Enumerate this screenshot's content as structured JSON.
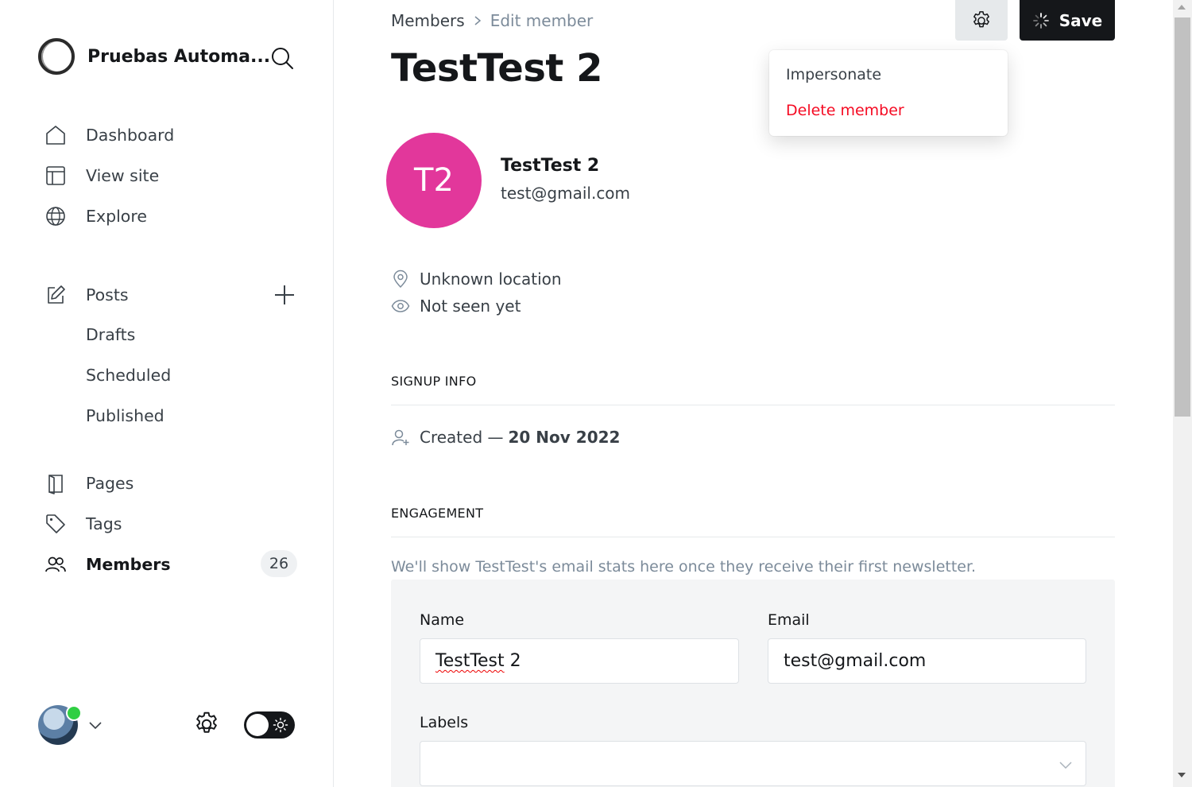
{
  "sidebar": {
    "site_name": "Pruebas Automa...",
    "nav": {
      "dashboard": "Dashboard",
      "view_site": "View site",
      "explore": "Explore",
      "posts": "Posts",
      "drafts": "Drafts",
      "scheduled": "Scheduled",
      "published": "Published",
      "pages": "Pages",
      "tags": "Tags",
      "members": "Members",
      "members_count": "26"
    },
    "icons": [
      "house-icon",
      "layout-icon",
      "globe-icon",
      "pencil-square-icon",
      "plus-icon",
      "page-icon",
      "tag-icon",
      "users-icon",
      "gear-icon",
      "chevron-down-icon",
      "sun-icon",
      "search-icon"
    ]
  },
  "breadcrumb": {
    "parent": "Members",
    "current": "Edit member"
  },
  "page_title": "TestTest 2",
  "actions": {
    "save_label": "Save"
  },
  "settings_menu": {
    "items": [
      "Impersonate",
      "Delete member"
    ]
  },
  "member": {
    "initials": "T2",
    "name": "TestTest 2",
    "email": "test@gmail.com",
    "location": "Unknown location",
    "last_seen": "Not seen yet"
  },
  "signup_info": {
    "heading": "SIGNUP INFO",
    "created_label": "Created —",
    "created_date": "20 Nov 2022"
  },
  "engagement": {
    "heading": "ENGAGEMENT",
    "note": "We'll show TestTest's email stats here once they receive their first newsletter."
  },
  "form": {
    "name_label": "Name",
    "name_value": "TestTest 2",
    "name_value_part1": "TestTest",
    "name_value_part2": " 2",
    "email_label": "Email",
    "email_value": "test@gmail.com",
    "labels_label": "Labels"
  },
  "colors": {
    "avatar": "#e2379b",
    "danger": "#f50b23",
    "online": "#30cf43",
    "dark": "#15171a"
  }
}
